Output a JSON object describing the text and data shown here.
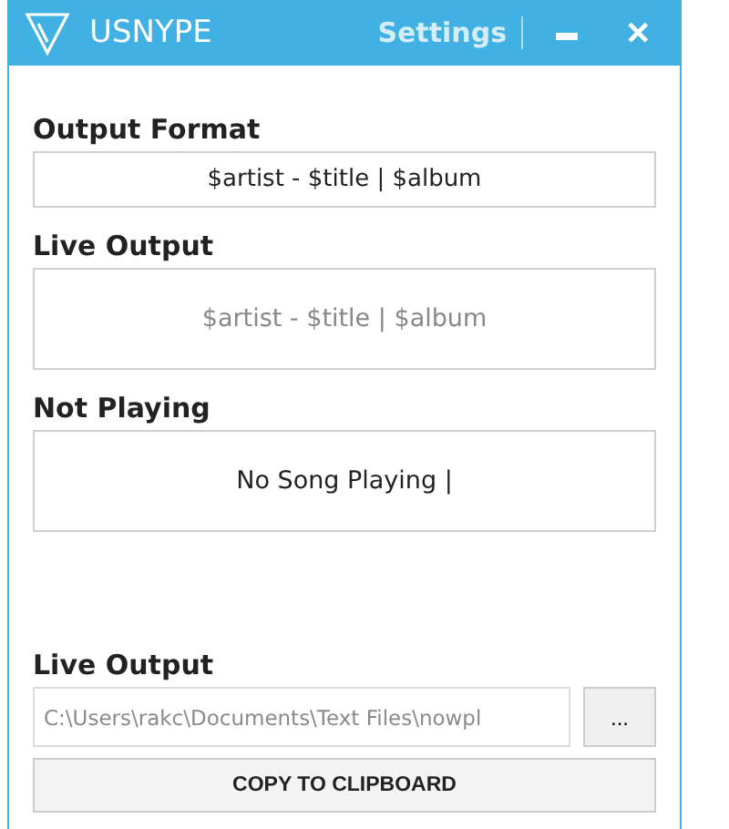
{
  "window": {
    "title": "USNYPE",
    "menu": "Settings",
    "buttons": [
      {
        "kind": "minimize"
      },
      {
        "kind": "close",
        "label": "✕"
      }
    ]
  },
  "sections": [
    {
      "heading": "Output Format",
      "kind": "input",
      "value": "$artist - $title | $album"
    },
    {
      "heading": "Live Output",
      "kind": "preview",
      "text": "$artist - $title | $album",
      "muted": true
    },
    {
      "heading": "Not Playing",
      "kind": "preview",
      "text": "No Song Playing |",
      "muted": false
    }
  ],
  "file_output": {
    "heading": "Live Output",
    "path": "C:\\Users\\rakc\\Documents\\Text Files\\nowpl",
    "browse": "...",
    "copy_button": "COPY TO CLIPBOARD"
  }
}
